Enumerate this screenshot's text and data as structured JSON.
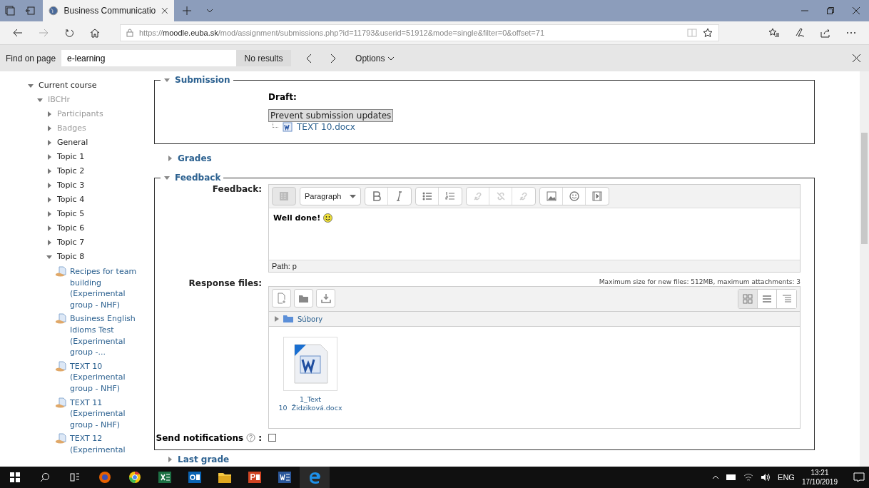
{
  "browser": {
    "tab_title": "Business Communicatio",
    "url": {
      "scheme": "https://",
      "host": "moodle.euba.sk",
      "path": "/mod/assignment/submissions.php?id=11793&userid=51912&mode=single&filter=0&offset=71"
    }
  },
  "find_bar": {
    "label": "Find on page",
    "value": "e-learning",
    "result": "No results",
    "options": "Options"
  },
  "sidebar": {
    "items": [
      {
        "label": "Current course",
        "kind": "folder",
        "expanded": true,
        "dimmed": false,
        "children": [
          {
            "label": "IBCHr",
            "kind": "folder",
            "expanded": true,
            "dimmed": true,
            "children": [
              {
                "label": "Participants",
                "kind": "folder",
                "expanded": false,
                "dimmed": true
              },
              {
                "label": "Badges",
                "kind": "folder",
                "expanded": false,
                "dimmed": true
              },
              {
                "label": "General",
                "kind": "folder",
                "expanded": false,
                "dimmed": false
              },
              {
                "label": "Topic 1",
                "kind": "folder",
                "expanded": false,
                "dimmed": false
              },
              {
                "label": "Topic 2",
                "kind": "folder",
                "expanded": false,
                "dimmed": false
              },
              {
                "label": "Topic 3",
                "kind": "folder",
                "expanded": false,
                "dimmed": false
              },
              {
                "label": "Topic 4",
                "kind": "folder",
                "expanded": false,
                "dimmed": false
              },
              {
                "label": "Topic 5",
                "kind": "folder",
                "expanded": false,
                "dimmed": false
              },
              {
                "label": "Topic 6",
                "kind": "folder",
                "expanded": false,
                "dimmed": false
              },
              {
                "label": "Topic 7",
                "kind": "folder",
                "expanded": false,
                "dimmed": false
              },
              {
                "label": "Topic 8",
                "kind": "folder",
                "expanded": true,
                "dimmed": false,
                "children": [
                  {
                    "label": "Recipes for team building (Experimental group - NHF)",
                    "kind": "activity"
                  },
                  {
                    "label": "Business English Idioms Test (Experimental group -...",
                    "kind": "activity"
                  },
                  {
                    "label": "TEXT 10 (Experimental group - NHF)",
                    "kind": "activity"
                  },
                  {
                    "label": "TEXT 11 (Experimental group - NHF)",
                    "kind": "activity"
                  },
                  {
                    "label": "TEXT 12 (Experimental",
                    "kind": "activity"
                  }
                ]
              }
            ]
          }
        ]
      }
    ]
  },
  "submission": {
    "legend": "Submission",
    "expanded": true,
    "status": "Draft:",
    "button": "Prevent submission updates",
    "file": "TEXT 10.docx"
  },
  "grades": {
    "legend": "Grades",
    "expanded": false
  },
  "feedback": {
    "legend": "Feedback",
    "expanded": true,
    "label": "Feedback:",
    "toolbar": [
      [
        {
          "kind": "collapse",
          "disabled": false
        }
      ],
      [
        {
          "kind": "format",
          "text": "Paragraph"
        }
      ],
      [
        {
          "kind": "bold",
          "disabled": false
        },
        {
          "kind": "italic",
          "disabled": false
        }
      ],
      [
        {
          "kind": "bullets",
          "disabled": false
        },
        {
          "kind": "numbers",
          "disabled": false
        }
      ],
      [
        {
          "kind": "link",
          "disabled": true
        },
        {
          "kind": "unlink",
          "disabled": true
        },
        {
          "kind": "link",
          "disabled": true
        }
      ],
      [
        {
          "kind": "image",
          "disabled": false
        },
        {
          "kind": "emoticon",
          "disabled": false
        },
        {
          "kind": "media",
          "disabled": false
        }
      ]
    ],
    "text": "Well done!",
    "path": "Path: p",
    "files_label": "Response files:",
    "limits": "Maximum size for new files: 512MB, maximum attachments: 3",
    "folder": "Súbory",
    "file": [
      "1_Text",
      "10  Židziková.docx"
    ],
    "notifications_label": "Send notifications",
    "notifications_colon": ":",
    "notifications_checked": false
  },
  "last_grade": {
    "legend": "Last grade",
    "expanded": false
  },
  "taskbar": {
    "language": "ENG",
    "time": "13:21",
    "date": "17/10/2019"
  }
}
